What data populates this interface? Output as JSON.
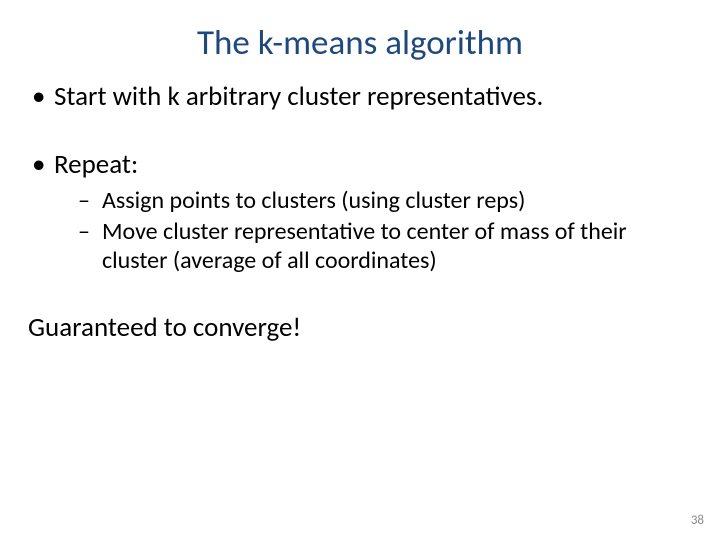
{
  "title": "The k-means algorithm",
  "bullets": {
    "b1": "Start with k arbitrary cluster representatives.",
    "b2": "Repeat:",
    "sub1": "Assign points to clusters (using cluster reps)",
    "sub2": "Move cluster representative to center of mass of their cluster (average of all coordinates)"
  },
  "closing": "Guaranteed to converge!",
  "page_number": "38"
}
